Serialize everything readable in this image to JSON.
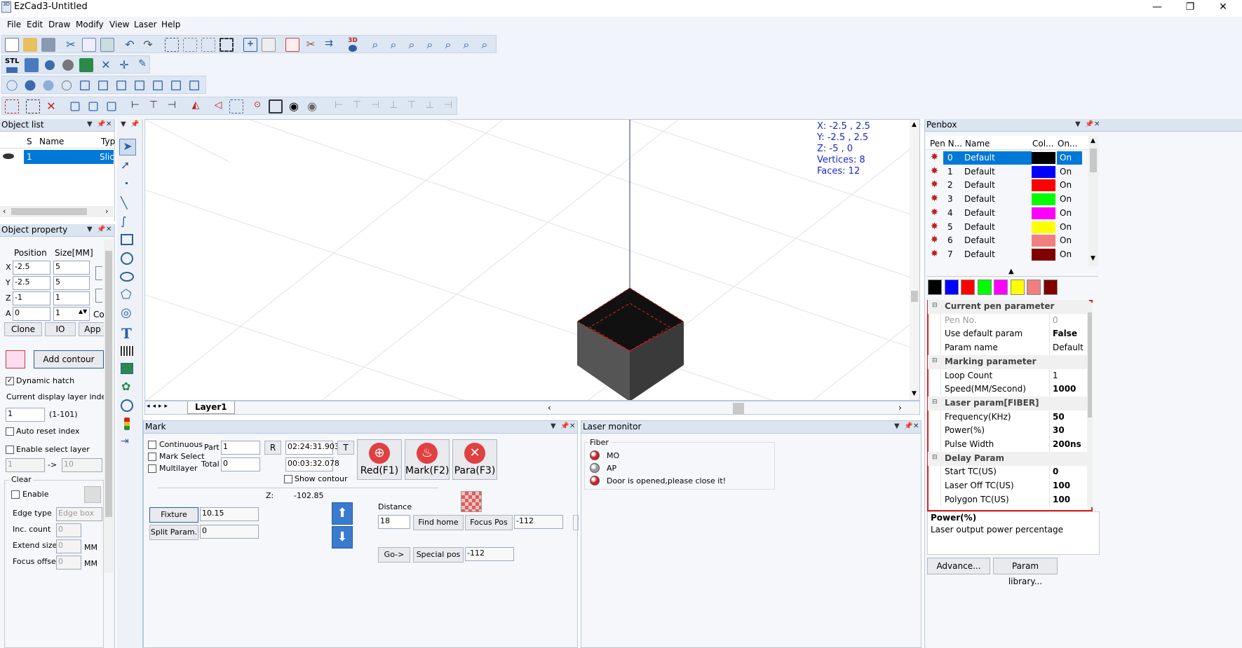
{
  "window": {
    "title": "EzCad3-Untitled",
    "icon_text": "3D",
    "minimize": "—",
    "maximize": "❐",
    "close": "✕"
  },
  "menu": [
    "File",
    "Edit",
    "Draw",
    "Modify",
    "View",
    "Laser",
    "Help"
  ],
  "toolbar": {
    "stl_label": "STL",
    "3d_label": "3D"
  },
  "object_list": {
    "title": "Object list",
    "headers": [
      "S",
      "Name",
      "Typ"
    ],
    "row": {
      "s": "1",
      "name": "",
      "type": "Slic"
    }
  },
  "object_property": {
    "title": "Object property",
    "position_label": "Position",
    "size_label": "Size[MM]",
    "rows": [
      {
        "axis": "X",
        "pos": "-2.5",
        "size": "5"
      },
      {
        "axis": "Y",
        "pos": "-2.5",
        "size": "5"
      },
      {
        "axis": "Z",
        "pos": "-1",
        "size": "1"
      },
      {
        "axis": "A",
        "pos": "0",
        "size": "1"
      }
    ],
    "co_label": "Co",
    "clone": "Clone",
    "io": "IO",
    "app": "App",
    "add_contour": "Add contour",
    "dynamic_hatch": "Dynamic hatch",
    "layer_index_label": "Current display layer index",
    "layer_index": "1",
    "layer_range": "(1-101)",
    "auto_reset": "Auto reset index",
    "enable_select_layer": "Enable select layer",
    "from": "1",
    "arrow": "->",
    "to": "10",
    "clear_group": "Clear",
    "enable": "Enable",
    "edge_type_label": "Edge type",
    "edge_type": "Edge box",
    "inc_count_label": "Inc. count",
    "inc_count": "0",
    "extend_size_label": "Extend size",
    "extend_size": "0",
    "mm1": "MM",
    "focus_offset_label": "Focus offset",
    "focus_offset": "0",
    "mm2": "MM"
  },
  "viewport": {
    "info": [
      "X: -2.5 , 2.5",
      "Y: -2.5 , 2.5",
      "Z: -5 , 0",
      "Vertices: 8",
      "Faces: 12"
    ],
    "layer_tab": "Layer1"
  },
  "mark": {
    "title": "Mark",
    "continuous": "Continuous",
    "mark_select": "Mark Select",
    "multilayer": "Multilayer",
    "part_label": "Part",
    "part": "1",
    "total_label": "Total",
    "total": "0",
    "r": "R",
    "t": "T",
    "time1": "02:24:31.903",
    "time2": "00:03:32.078",
    "show_contour": "Show contour",
    "red": "Red(F1)",
    "markf2": "Mark(F2)",
    "para": "Para(F3)",
    "z_label": "Z:",
    "z_value": "-102.85",
    "fixture_offset": "Fixture Offset",
    "fixture_value": "10.15",
    "split_param": "Split Param.",
    "split_value": "0",
    "distance_label": "Distance",
    "distance": "18",
    "find_home": "Find home",
    "focus_pos": "Focus Pos",
    "focus_value": "-112",
    "go": "Go->",
    "special_pos": "Special pos",
    "special_value": "-112"
  },
  "laser_monitor": {
    "title": "Laser monitor",
    "group": "Fiber",
    "items": [
      {
        "label": "MO",
        "color": "#d02020"
      },
      {
        "label": "AP",
        "color": "#9a9a9a"
      },
      {
        "label": "Door is opened,please close it!",
        "color": "#d02020"
      }
    ]
  },
  "penbox": {
    "title": "Penbox",
    "headers": [
      "Pen N...",
      "Name",
      "Col...",
      "On..."
    ],
    "pens": [
      {
        "no": "0",
        "name": "Default",
        "color": "#000000",
        "on": "On"
      },
      {
        "no": "1",
        "name": "Default",
        "color": "#0000ff",
        "on": "On"
      },
      {
        "no": "2",
        "name": "Default",
        "color": "#ff0000",
        "on": "On"
      },
      {
        "no": "3",
        "name": "Default",
        "color": "#00ff00",
        "on": "On"
      },
      {
        "no": "4",
        "name": "Default",
        "color": "#ff00ff",
        "on": "On"
      },
      {
        "no": "5",
        "name": "Default",
        "color": "#ffff00",
        "on": "On"
      },
      {
        "no": "6",
        "name": "Default",
        "color": "#f08080",
        "on": "On"
      },
      {
        "no": "7",
        "name": "Default",
        "color": "#800000",
        "on": "On"
      }
    ],
    "swatches": [
      "#000000",
      "#0000ff",
      "#ff0000",
      "#00ff00",
      "#ff00ff",
      "#ffff00",
      "#f08080",
      "#800000"
    ],
    "params": [
      {
        "kind": "section",
        "label": "Current pen parameter"
      },
      {
        "kind": "row",
        "label": "Pen No.",
        "value": "0",
        "dim": true
      },
      {
        "kind": "row",
        "label": "Use default param",
        "value": "False",
        "bold": true
      },
      {
        "kind": "row",
        "label": "Param name",
        "value": "Default"
      },
      {
        "kind": "section",
        "label": "Marking parameter"
      },
      {
        "kind": "row",
        "label": "Loop Count",
        "value": "1"
      },
      {
        "kind": "row",
        "label": "Speed(MM/Second)",
        "value": "1000",
        "bold": true
      },
      {
        "kind": "section",
        "label": "Laser param[FIBER]"
      },
      {
        "kind": "row",
        "label": "Frequency(KHz)",
        "value": "50",
        "bold": true
      },
      {
        "kind": "row",
        "label": "Power(%)",
        "value": "30",
        "bold": true
      },
      {
        "kind": "row",
        "label": "Pulse Width",
        "value": "200ns",
        "bold": true
      },
      {
        "kind": "section",
        "label": "Delay Param"
      },
      {
        "kind": "row",
        "label": "Start TC(US)",
        "value": "0",
        "bold": true
      },
      {
        "kind": "row",
        "label": "Laser Off TC(US)",
        "value": "100",
        "bold": true
      },
      {
        "kind": "row",
        "label": "Polygon TC(US)",
        "value": "100",
        "bold": true
      }
    ],
    "desc_title": "Power(%)",
    "desc_text": "Laser output power percentage",
    "advance": "Advance...",
    "param_library": "Param library..."
  },
  "colors": {
    "accent": "#0078d7",
    "highlight_border": "#e02020"
  }
}
